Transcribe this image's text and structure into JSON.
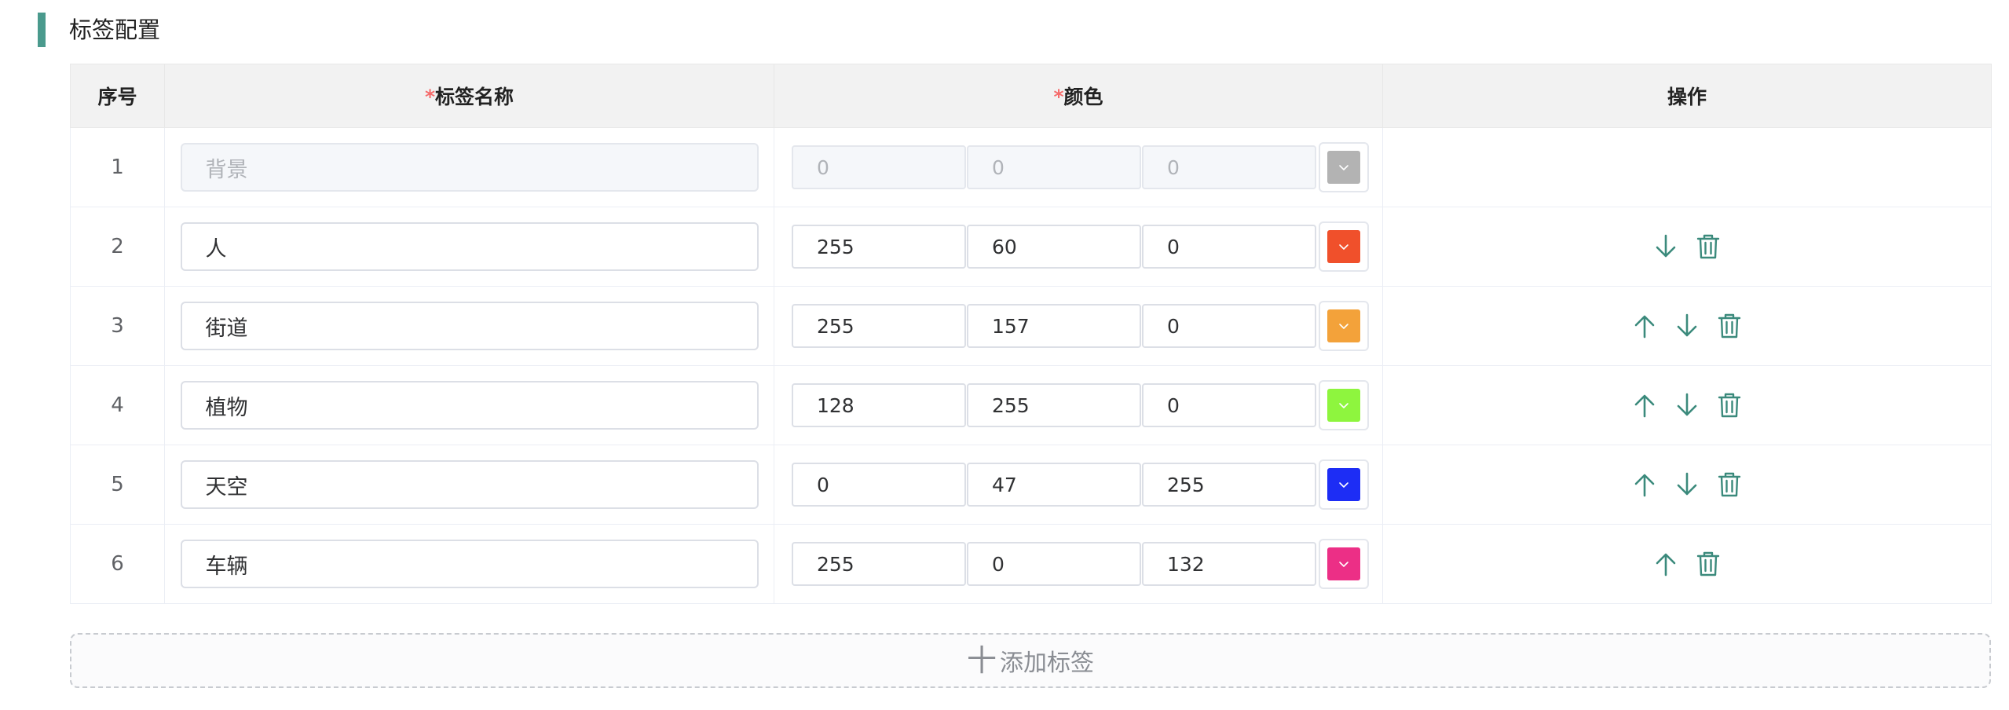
{
  "section": {
    "title": "标签配置"
  },
  "table": {
    "headers": {
      "index": "序号",
      "name_star": "*",
      "name": "标签名称",
      "color_star": "*",
      "color": "颜色",
      "ops": "操作"
    },
    "rows": [
      {
        "index": "1",
        "name": "背景",
        "r": "0",
        "g": "0",
        "b": "0",
        "color": "#b3b3b3",
        "disabled": true,
        "up": false,
        "down": false,
        "delete": false
      },
      {
        "index": "2",
        "name": "人",
        "r": "255",
        "g": "60",
        "b": "0",
        "color": "#f0502b",
        "disabled": false,
        "up": false,
        "down": true,
        "delete": true
      },
      {
        "index": "3",
        "name": "街道",
        "r": "255",
        "g": "157",
        "b": "0",
        "color": "#f3a23a",
        "disabled": false,
        "up": true,
        "down": true,
        "delete": true
      },
      {
        "index": "4",
        "name": "植物",
        "r": "128",
        "g": "255",
        "b": "0",
        "color": "#8ef53e",
        "disabled": false,
        "up": true,
        "down": true,
        "delete": true
      },
      {
        "index": "5",
        "name": "天空",
        "r": "0",
        "g": "47",
        "b": "255",
        "color": "#1d2df5",
        "disabled": false,
        "up": true,
        "down": true,
        "delete": true
      },
      {
        "index": "6",
        "name": "车辆",
        "r": "255",
        "g": "0",
        "b": "132",
        "color": "#ec2f86",
        "disabled": false,
        "up": true,
        "down": false,
        "delete": true
      }
    ]
  },
  "add_button": {
    "plus": "十",
    "label": "添加标签"
  },
  "icons": {
    "up": "arrow-up-icon",
    "down": "arrow-down-icon",
    "delete": "trash-icon",
    "dropdown": "chevron-down-icon"
  },
  "colors": {
    "accent": "#4a9a8d",
    "icon": "#3b8a7c"
  }
}
